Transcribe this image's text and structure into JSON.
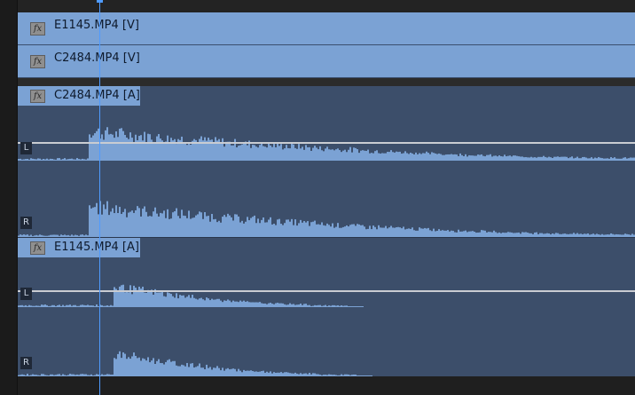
{
  "timeline": {
    "accent_color": "#4f9bff",
    "video_clip_color": "#7ba2d4",
    "audio_clip_color": "#3c4e6a",
    "video_clips": [
      {
        "name": "E1145.MP4 [V]",
        "fx_label": "fx"
      },
      {
        "name": "C2484.MP4 [V]",
        "fx_label": "fx"
      }
    ],
    "audio_clips": [
      {
        "name": "C2484.MP4 [A]",
        "fx_label": "fx",
        "channel_left": "L",
        "channel_right": "R"
      },
      {
        "name": "E1145.MP4 [A]",
        "fx_label": "fx",
        "channel_left": "L",
        "channel_right": "R"
      }
    ]
  }
}
